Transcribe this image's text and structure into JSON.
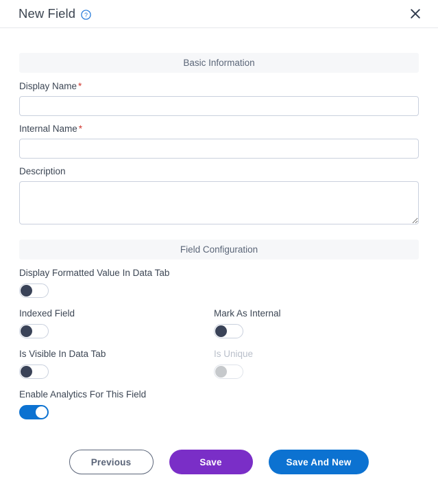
{
  "header": {
    "title": "New Field",
    "help_icon": "help-circle-icon",
    "close_icon": "close-icon"
  },
  "sections": {
    "basic": {
      "title": "Basic Information",
      "fields": [
        {
          "label": "Display Name",
          "required_marker": "*",
          "value": "",
          "placeholder": ""
        },
        {
          "label": "Internal Name",
          "required_marker": "*",
          "value": "",
          "placeholder": ""
        }
      ],
      "description": {
        "label": "Description",
        "value": "",
        "placeholder": ""
      }
    },
    "configuration": {
      "title": "Field Configuration",
      "toggles": [
        {
          "label": "Display Formatted Value In Data Tab",
          "state": "off",
          "disabled": false
        },
        {
          "label": "Indexed Field",
          "state": "off",
          "disabled": false
        },
        {
          "label": "Mark As Internal",
          "state": "off",
          "disabled": false
        },
        {
          "label": "Is Visible In Data Tab",
          "state": "off",
          "disabled": false
        },
        {
          "label": "Is Unique",
          "state": "off",
          "disabled": true
        },
        {
          "label": "Enable Analytics For This Field",
          "state": "on",
          "disabled": false
        }
      ]
    }
  },
  "footer": {
    "previous_label": "Previous",
    "save_label": "Save",
    "save_and_new_label": "Save And New"
  },
  "colors": {
    "accent_blue": "#0c72d1",
    "accent_purple": "#7a2ec7",
    "toggle_off_knob": "#3a4358",
    "toggle_disabled_knob": "#c6c9cc",
    "required_red": "#d0342c",
    "section_bar_bg": "#f6f7f9",
    "section_bar_text": "#5b6678",
    "border": "#c9d0dd"
  }
}
